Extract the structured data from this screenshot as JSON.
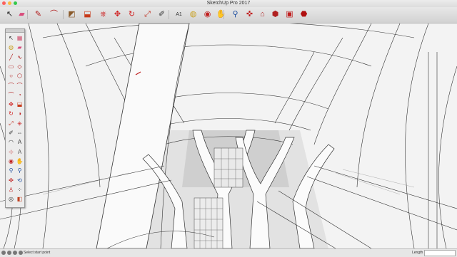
{
  "window": {
    "title": "SketchUp Pro 2017"
  },
  "toolbar": {
    "tools": [
      {
        "name": "select-tool",
        "icon": "arrow-icon",
        "glyph": "↖",
        "color": "#222222"
      },
      {
        "name": "eraser-tool",
        "icon": "eraser-icon",
        "glyph": "▰",
        "color": "#d84a7a"
      },
      {
        "name": "line-tool",
        "icon": "pencil-icon",
        "glyph": "✎",
        "color": "#b01818"
      },
      {
        "name": "arc-tool",
        "icon": "arc-icon",
        "glyph": "⌒",
        "color": "#b01818"
      },
      {
        "name": "rectangle-tool",
        "icon": "rectangle-icon",
        "glyph": "◩",
        "color": "#8a5a2a"
      },
      {
        "name": "push-pull-tool",
        "icon": "push-pull-icon",
        "glyph": "⬓",
        "color": "#c83a1a"
      },
      {
        "name": "offset-tool",
        "icon": "offset-icon",
        "glyph": "⎈",
        "color": "#cc2222"
      },
      {
        "name": "move-tool",
        "icon": "move-icon",
        "glyph": "✥",
        "color": "#d02020"
      },
      {
        "name": "rotate-tool",
        "icon": "rotate-icon",
        "glyph": "↻",
        "color": "#d02020"
      },
      {
        "name": "scale-tool",
        "icon": "scale-icon",
        "glyph": "⤢",
        "color": "#c03020"
      },
      {
        "name": "tape-measure-tool",
        "icon": "tape-measure-icon",
        "glyph": "✐",
        "color": "#333333"
      },
      {
        "name": "text-tool",
        "icon": "text-icon",
        "glyph": "A1",
        "color": "#333333"
      },
      {
        "name": "paint-bucket-tool",
        "icon": "paint-bucket-icon",
        "glyph": "◍",
        "color": "#c8a020"
      },
      {
        "name": "orbit-tool",
        "icon": "orbit-icon",
        "glyph": "◉",
        "color": "#c02020"
      },
      {
        "name": "pan-tool",
        "icon": "pan-icon",
        "glyph": "✋",
        "color": "#d0a070"
      },
      {
        "name": "zoom-tool",
        "icon": "zoom-icon",
        "glyph": "⚲",
        "color": "#2050a0"
      },
      {
        "name": "zoom-extents-tool",
        "icon": "zoom-extents-icon",
        "glyph": "✜",
        "color": "#c02020"
      },
      {
        "name": "3d-warehouse-button",
        "icon": "warehouse-icon",
        "glyph": "⌂",
        "color": "#b02020"
      },
      {
        "name": "extension-warehouse-button",
        "icon": "extension-icon",
        "glyph": "⬢",
        "color": "#b02020"
      },
      {
        "name": "layout-button",
        "icon": "layout-icon",
        "glyph": "▣",
        "color": "#c02020"
      },
      {
        "name": "extension-manager-button",
        "icon": "ruby-icon",
        "glyph": "⬣",
        "color": "#b01010"
      }
    ]
  },
  "palette": {
    "rows": [
      [
        "select-icon",
        "↖",
        "#222222",
        "component-icon",
        "▦",
        "#d04a6a"
      ],
      [
        "paint-icon",
        "◍",
        "#c8a020",
        "eraser-icon",
        "▰",
        "#d84a7a"
      ],
      [
        "line-icon",
        "╱",
        "#b01818",
        "freehand-icon",
        "∿",
        "#b01818"
      ],
      [
        "rectangle-icon",
        "▭",
        "#b01818",
        "rotated-rectangle-icon",
        "◇",
        "#b01818"
      ],
      [
        "circle-icon",
        "○",
        "#b01818",
        "polygon-icon",
        "⬡",
        "#b01818"
      ],
      [
        "arc-icon",
        "⌒",
        "#b01818",
        "arc-2pt-icon",
        "⌒",
        "#b01818"
      ],
      [
        "arc-3pt-icon",
        "⌒",
        "#b01818",
        "pie-icon",
        "◔",
        "#b01818"
      ],
      [
        "move-icon",
        "✥",
        "#d02020",
        "push-pull-icon",
        "⬓",
        "#c83a1a"
      ],
      [
        "rotate-icon",
        "↻",
        "#d02020",
        "follow-me-icon",
        "◑",
        "#c02020"
      ],
      [
        "scale-icon",
        "⤢",
        "#c03020",
        "offset-icon",
        "⎈",
        "#cc2222"
      ],
      [
        "tape-icon",
        "✐",
        "#333333",
        "dimension-icon",
        "⇔",
        "#333333"
      ],
      [
        "protractor-icon",
        "◠",
        "#333333",
        "text-icon",
        "A",
        "#333333"
      ],
      [
        "axes-icon",
        "⊹",
        "#c02020",
        "3d-text-icon",
        "A",
        "#555555"
      ],
      [
        "orbit-icon",
        "◉",
        "#c02020",
        "pan-icon",
        "✋",
        "#d0a070"
      ],
      [
        "zoom-icon",
        "⚲",
        "#2050a0",
        "zoom-window-icon",
        "⚲",
        "#2050a0"
      ],
      [
        "zoom-extents-icon",
        "✜",
        "#c02020",
        "previous-icon",
        "⟲",
        "#2050a0"
      ],
      [
        "position-camera-icon",
        "♙",
        "#c02020",
        "walk-icon",
        "⁘",
        "#333333"
      ],
      [
        "look-around-icon",
        "◎",
        "#333333",
        "section-plane-icon",
        "◧",
        "#c04020"
      ]
    ]
  },
  "status": {
    "text": "Select start point",
    "length_label": "Length",
    "length_value": ""
  },
  "colors": {
    "viewport_bg": "#f4f4f4",
    "edge": "#333333",
    "face_shadow": "#d8d8d8"
  }
}
